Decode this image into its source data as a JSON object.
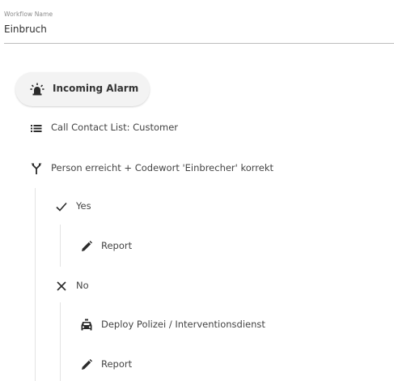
{
  "workflow": {
    "name_label": "Workflow Name",
    "name_value": "Einbruch"
  },
  "trigger": {
    "label": "Incoming Alarm",
    "icon": "alarm-light-icon"
  },
  "steps": {
    "call_contact": {
      "label": "Call Contact List: Customer",
      "icon": "list-icon"
    },
    "condition": {
      "label": "Person erreicht + Codewort 'Einbrecher' korrekt",
      "icon": "branch-icon"
    },
    "yes_branch": {
      "label": "Yes",
      "icon": "check-icon",
      "children": {
        "report": {
          "label": "Report",
          "icon": "pencil-icon"
        }
      }
    },
    "no_branch": {
      "label": "No",
      "icon": "close-icon",
      "children": {
        "deploy": {
          "label": "Deploy Polizei / Interventionsdienst",
          "icon": "car-icon"
        },
        "report": {
          "label": "Report",
          "icon": "pencil-icon"
        }
      }
    }
  },
  "colors": {
    "icon": "#2b2b2b",
    "text": "#444444",
    "guide_line": "#e3e3e3",
    "pill_bg": "#f3f3f3",
    "underline": "#bdbdbd"
  }
}
